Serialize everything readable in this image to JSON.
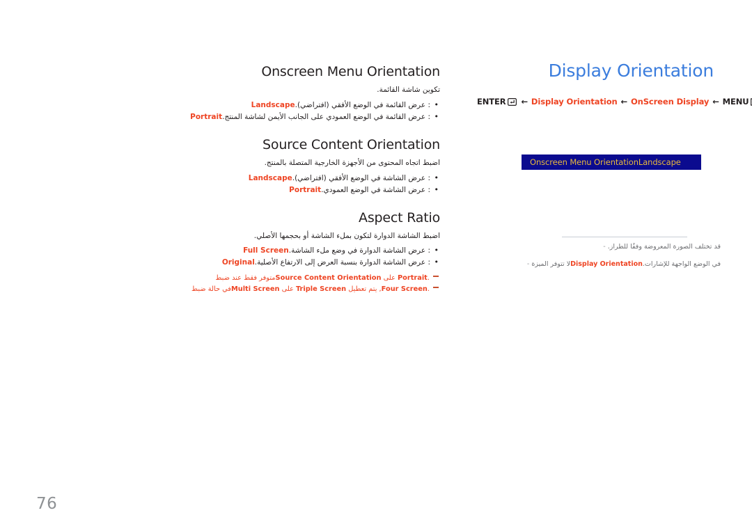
{
  "page": {
    "number": "76"
  },
  "header": {
    "title": "Display Orientation",
    "title_color": "#3b7ddd"
  },
  "breadcrumb": {
    "separator": "←",
    "items": [
      {
        "label": "ENTER",
        "accent": false,
        "icon": "enter-key-icon"
      },
      {
        "label": "Display Orientation",
        "accent": true
      },
      {
        "label": "OnScreen Display",
        "accent": true
      },
      {
        "label": "MENU",
        "accent": false,
        "icon": "menu-key-icon"
      }
    ]
  },
  "osd_preview": {
    "background": "#0b0b8f",
    "text_color": "#e8b93c",
    "label": "Onscreen Menu Orientation",
    "value": "Landscape"
  },
  "right_notes": [
    {
      "dash": "-",
      "text": "قد تختلف الصورة المعروضة وفقًا للطراز.",
      "accent_before": "",
      "accent": "",
      "accent_after": ""
    },
    {
      "dash": "-",
      "text": "",
      "accent_before": "لا تتوفر الميزة ",
      "accent": "Display Orientation",
      "accent_after": " في الوضع الواجهة للإشارات."
    }
  ],
  "sections": [
    {
      "heading": "Onscreen Menu Orientation",
      "lead": "تكوين شاشة القائمة.",
      "bullets": [
        {
          "term": "Landscape",
          "text": ": عرض القائمة في الوضع الأفقي (افتراضي)."
        },
        {
          "term": "Portrait",
          "text": ": عرض القائمة في الوضع العمودي على الجانب الأيمن لشاشة المنتج."
        }
      ],
      "dashnotes": []
    },
    {
      "heading": "Source Content Orientation",
      "lead": "اضبط اتجاه المحتوى من الأجهزة الخارجية المتصلة بالمنتج.",
      "bullets": [
        {
          "term": "Landscape",
          "text": ": عرض الشاشة في الوضع الأفقي (افتراضي)."
        },
        {
          "term": "Portrait",
          "text": ": عرض الشاشة في الوضع العمودي."
        }
      ],
      "dashnotes": []
    },
    {
      "heading": "Aspect Ratio",
      "lead": "اضبط الشاشة الدوارة لتكون بملء الشاشة أو بحجمها الأصلي.",
      "bullets": [
        {
          "term": "Full Screen",
          "text": ": عرض الشاشة الدوارة في وضع ملء الشاشة."
        },
        {
          "term": "Original",
          "text": ": عرض الشاشة الدوارة بنسبة العرض إلى الارتفاع الأصلية."
        }
      ],
      "dashnotes": [
        {
          "a": "متوفر فقط عند ضبط ",
          "b": "Source Content Orientation",
          "c": " على ",
          "d": "Portrait",
          "e": "."
        },
        {
          "a": "في حالة ضبط ",
          "b": "Multi Screen",
          "c": " على ",
          "d": "Triple Screen",
          "e": ", يتم تعطيل ",
          "f": "Four Screen",
          "g": "."
        }
      ]
    }
  ]
}
